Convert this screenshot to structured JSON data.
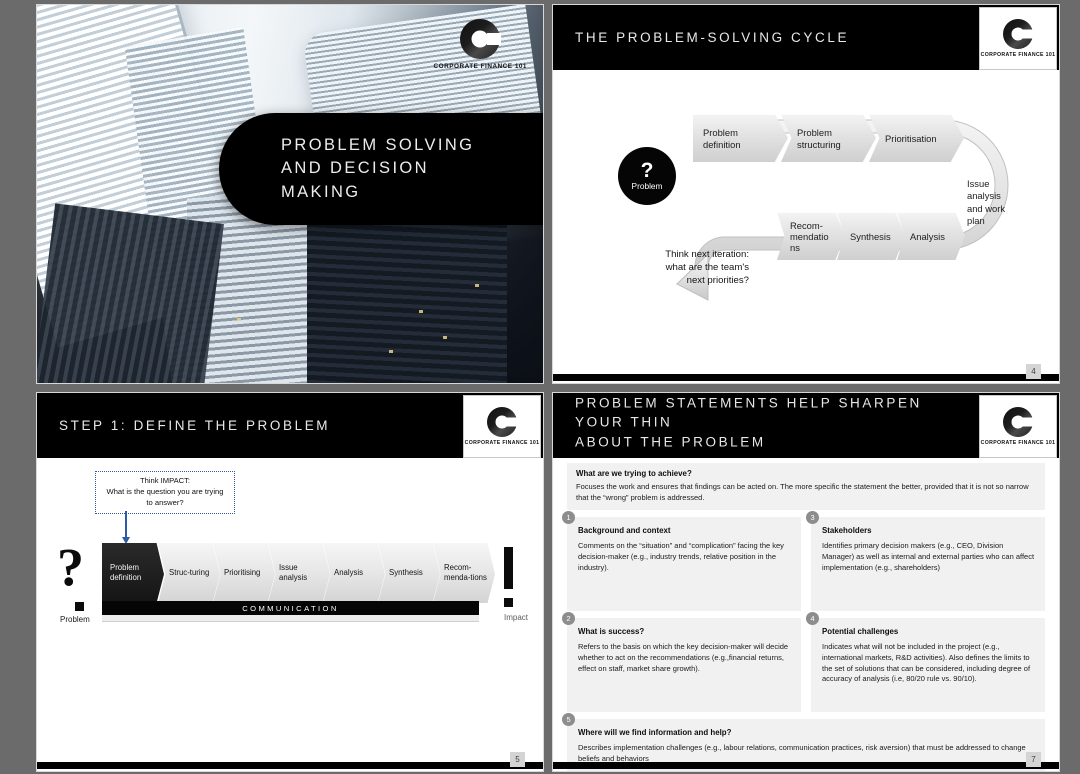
{
  "brand": {
    "logo_text": "CORPORATE FINANCE 101",
    "logo_icon": "letter-c-logo"
  },
  "slides": [
    {
      "id": "cover",
      "title": "PROBLEM SOLVING\nAND DECISION\nMAKING",
      "page": ""
    },
    {
      "id": "cycle",
      "title": "THE PROBLEM-SOLVING CYCLE",
      "page": "4",
      "problem_circle": {
        "symbol": "?",
        "label": "Problem"
      },
      "top_steps": [
        "Problem\ndefinition",
        "Problem\nstructuring",
        "Prioritisation"
      ],
      "right_step": "Issue\nanalysis\nand work\nplan",
      "bottom_steps": [
        "Recom-\nmendatio\nns",
        "Synthesis",
        "Analysis"
      ],
      "note": "Think next iteration:\nwhat are the team's\nnext priorities?"
    },
    {
      "id": "step1",
      "title": "STEP 1: DEFINE THE PROBLEM",
      "page": "5",
      "callout": "Think IMPACT:\nWhat is the question you are trying\nto answer?",
      "start_symbol": "?",
      "start_label": "Problem",
      "end_symbol": "!",
      "end_label": "Impact",
      "steps": [
        "Problem\ndefinition",
        "Struc-turing",
        "Prioritising",
        "Issue\nanalysis",
        "Analysis",
        "Synthesis",
        "Recom-\nmenda-tions"
      ],
      "band_label": "COMMUNICATION"
    },
    {
      "id": "statements",
      "title": "PROBLEM STATEMENTS HELP SHARPEN YOUR THIN\nABOUT THE PROBLEM",
      "page": "7",
      "intro": {
        "heading": "What are we trying to achieve?",
        "body": "Focuses the work and ensures that findings can be acted on. The more specific the statement the better, provided that it is not so narrow that the “wrong” problem is addressed."
      },
      "items": [
        {
          "number": "1",
          "heading": "Background and context",
          "body": "Comments on the “situation” and “complication” facing the key decision-maker (e.g., industry trends, relative position in the industry)."
        },
        {
          "number": "3",
          "heading": "Stakeholders",
          "body": "Identifies primary decision makers (e.g., CEO, Division Manager) as well as internal and external parties who can affect implementation (e.g., shareholders)"
        },
        {
          "number": "2",
          "heading": "What is success?",
          "body": "Refers to the basis on which the key decision-maker will decide whether to act on the recommendations (e.g.,financial returns, effect on staff, market share growth)."
        },
        {
          "number": "4",
          "heading": "Potential challenges",
          "body": "Indicates what will not be included in the project (e.g., international markets, R&D activities). Also defines the limits to the set of solutions that can be considered, including degree of accuracy of analysis (i.e, 80/20 rule vs. 90/10)."
        }
      ],
      "last": {
        "number": "5",
        "heading": "Where will we find information and help?",
        "body": "Describes implementation challenges (e.g., labour relations, communication practices, risk aversion) that must be addressed to change beliefs and behaviors"
      }
    }
  ],
  "colors": {
    "deck_background": "#6b6b6b",
    "header_black": "#000000",
    "accent_blue": "#2f5aa8",
    "badge_gray": "#8d8d8d",
    "panel_gray": "#f1f1f1"
  }
}
